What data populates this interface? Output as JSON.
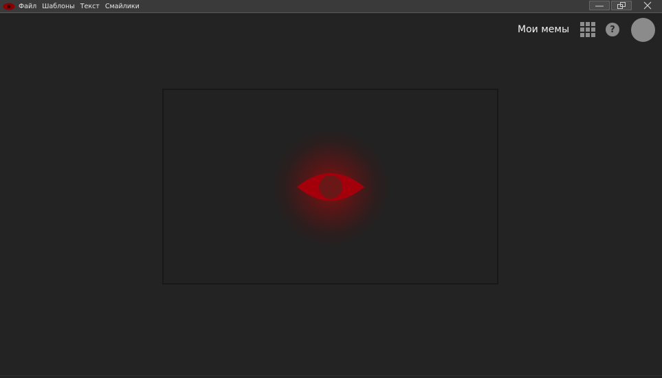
{
  "window": {
    "menu": [
      "Файл",
      "Шаблоны",
      "Текст",
      "Смайлики"
    ],
    "controls": [
      "minimize",
      "restore",
      "close"
    ]
  },
  "header": {
    "my_memes_label": "Мои мемы",
    "help_label": "?"
  },
  "icons": {
    "app_logo": "eye-logo-icon",
    "apps": "grid-icon",
    "help": "help-icon",
    "loading": "eye-icon"
  },
  "colors": {
    "accent": "#c8000a",
    "background": "#232323"
  }
}
